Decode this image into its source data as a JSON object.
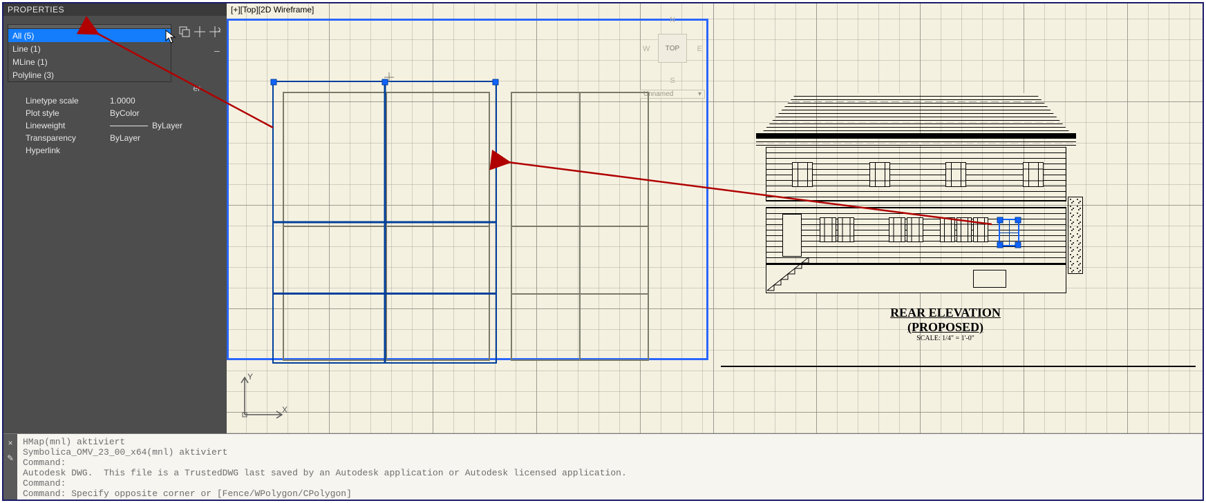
{
  "panel": {
    "title": "PROPERTIES",
    "selection": "All (5)",
    "dropdown": [
      "All (5)",
      "Line (1)",
      "MLine (1)",
      "Polyline (3)"
    ],
    "rows": {
      "linetype_scale_label": "Linetype scale",
      "linetype_scale_value": "1.0000",
      "plot_style_label": "Plot style",
      "plot_style_value": "ByColor",
      "lineweight_label": "Lineweight",
      "lineweight_value": "ByLayer",
      "transparency_label": "Transparency",
      "transparency_value": "ByLayer",
      "hyperlink_label": "Hyperlink",
      "hyperlink_value": ""
    },
    "peek_text": "er",
    "collapse_glyph": "–"
  },
  "viewport_left": {
    "label": "[+][Top][2D Wireframe]",
    "axis_y": "Y",
    "axis_x": "X"
  },
  "viewcube": {
    "n": "N",
    "s": "S",
    "e": "E",
    "w": "W",
    "face": "TOP",
    "dropdown": "Unnamed"
  },
  "elevation": {
    "title": "REAR ELEVATION (PROPOSED)",
    "scale": "SCALE: 1/4\" = 1'-0\""
  },
  "command": {
    "lines": [
      "HMap(mnl) aktiviert",
      "Symbolica_OMV_23_00_x64(mnl) aktiviert",
      "Command:",
      "Autodesk DWG.  This file is a TrustedDWG last saved by an Autodesk application or Autodesk licensed application.",
      "Command:",
      "Command: Specify opposite corner or [Fence/WPolygon/CPolygon]"
    ]
  }
}
